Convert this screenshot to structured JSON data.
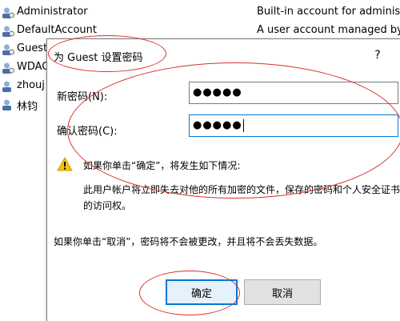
{
  "users": [
    {
      "name": "Administrator",
      "description": "Built-in account for administ",
      "icon": "user-icon"
    },
    {
      "name": "DefaultAccount",
      "description": "A user account managed by",
      "icon": "user-icon"
    },
    {
      "name": "Guest",
      "description": "",
      "icon": "user-icon"
    },
    {
      "name": "WDAG",
      "description": "",
      "icon": "user-icon"
    },
    {
      "name": "zhouj",
      "description": "",
      "icon": "user-icon"
    },
    {
      "name": "林钧",
      "description": "",
      "icon": "user-icon"
    }
  ],
  "dialog": {
    "title": "为 Guest 设置密码",
    "help_label": "?",
    "new_password_label": "新密码(N):",
    "new_password_value": "●●●●●",
    "confirm_password_label": "确认密码(C):",
    "confirm_password_value": "●●●●●",
    "warning_text": "如果你单击“确定”，将发生如下情况:",
    "info_text": "此用户帐户将立即失去对他的所有加密的文件，保存的密码和个人安全证书的访问权。",
    "cancel_info_text": "如果你单击“取消”，密码将不会被更改，并且将不会丢失数据。",
    "ok_label": "确定",
    "cancel_label": "取消"
  },
  "colors": {
    "annotation": "#d9302c",
    "focus_border": "#0078d7",
    "button_bg": "#e1e1e1"
  }
}
